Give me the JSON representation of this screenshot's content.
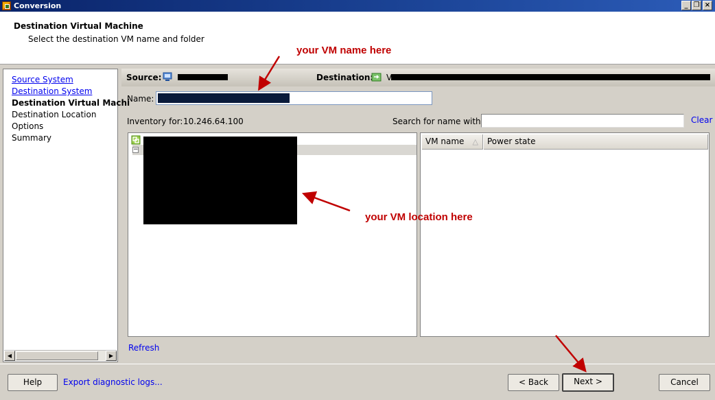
{
  "window": {
    "title": "Conversion",
    "minimize_glyph": "_",
    "restore_glyph": "❐",
    "close_glyph": "×"
  },
  "header": {
    "title": "Destination Virtual Machine",
    "subtitle": "Select the destination VM name and folder"
  },
  "nav": {
    "items": [
      {
        "label": "Source System",
        "state": "link"
      },
      {
        "label": "Destination System",
        "state": "link"
      },
      {
        "label": "Destination Virtual Machi",
        "state": "current"
      },
      {
        "label": "Destination Location",
        "state": "plain"
      },
      {
        "label": "Options",
        "state": "plain"
      },
      {
        "label": "Summary",
        "state": "plain"
      }
    ]
  },
  "main": {
    "source_label": "Source:",
    "destination_label": "Destination:",
    "destination_prefix": "V",
    "name_label": "Name:",
    "inventory_label": "Inventory for:",
    "inventory_host": "10.246.64.100",
    "search_label": "Search for name with:",
    "search_value": "",
    "clear_label": "Clear",
    "vm_columns": [
      "VM name",
      "Power state"
    ],
    "refresh_label": "Refresh"
  },
  "footer": {
    "help_label": "Help",
    "export_label": "Export diagnostic logs...",
    "back_label": "< Back",
    "next_label": "Next >",
    "cancel_label": "Cancel"
  },
  "annotations": {
    "name_note": "your VM name here",
    "location_note": "your VM location here"
  },
  "colors": {
    "annotation": "#c00000",
    "link": "#0000ee",
    "titlebar": "#0a246a",
    "redaction": "#000000"
  },
  "icons": [
    "app-icon",
    "source-machine-icon",
    "destination-vm-icon",
    "datacenter-icon",
    "tree-collapse-icon",
    "sort-arrow-icon"
  ]
}
